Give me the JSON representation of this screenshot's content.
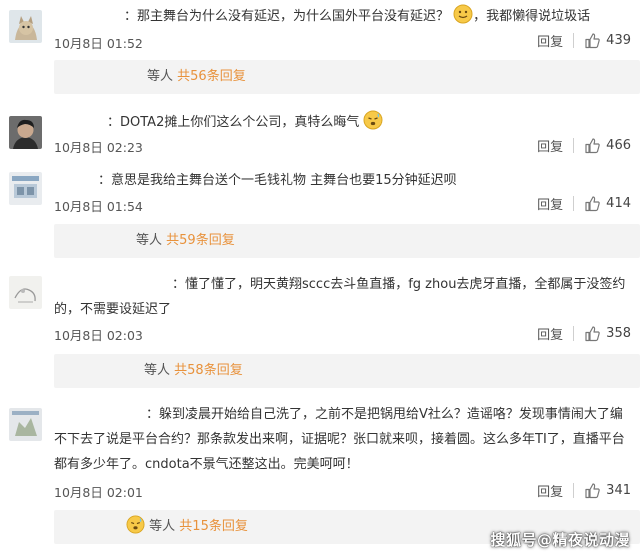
{
  "comments": [
    {
      "text": "：那主舞台为什么没有延迟，为什么国外平台没有延迟？",
      "text_tail": "，我都懒得说垃圾话",
      "date": "10月8日 01:52",
      "reply_label": "回复",
      "likes": "439",
      "replies": {
        "prefix": "等人",
        "count_text": "共56条回复"
      }
    },
    {
      "text": "：DOTA2摊上你们这么个公司，真特么晦气",
      "date": "10月8日 02:23",
      "reply_label": "回复",
      "likes": "466"
    },
    {
      "text": "：意思是我给主舞台送个一毛钱礼物 主舞台也要15分钟延迟呗",
      "date": "10月8日 01:54",
      "reply_label": "回复",
      "likes": "414",
      "replies": {
        "prefix": "等人",
        "count_text": "共59条回复"
      }
    },
    {
      "text": "：懂了懂了，明天黄翔sccc去斗鱼直播，fg zhou去虎牙直播，全都属于没签约的，不需要设延迟了",
      "date": "10月8日 02:03",
      "reply_label": "回复",
      "likes": "358",
      "replies": {
        "prefix": "等人",
        "count_text": "共58条回复"
      }
    },
    {
      "text": "：躲到凌晨开始给自己洗了，之前不是把锅甩给V社么？造谣咯？发现事情闹大了编不下去了说是平台合约？那条款发出来啊，证据呢？张口就来呗，接着圆。这么多年TI了，直播平台都有多少年了。cndota不景气还整这出。完美呵呵！",
      "date": "10月8日 02:01",
      "reply_label": "回复",
      "likes": "341",
      "replies": {
        "prefix": "等人",
        "count_text": "共15条回复"
      }
    }
  ],
  "watermark": "搜狐号@精夜说动漫",
  "colors": {
    "accent": "#e8923c",
    "replybar_bg": "#f3f3f3",
    "text": "#333333"
  },
  "icons": {
    "like": "thumbs-up-icon",
    "smile": "smile-emoji-icon",
    "sweat": "sweat-emoji-icon"
  }
}
